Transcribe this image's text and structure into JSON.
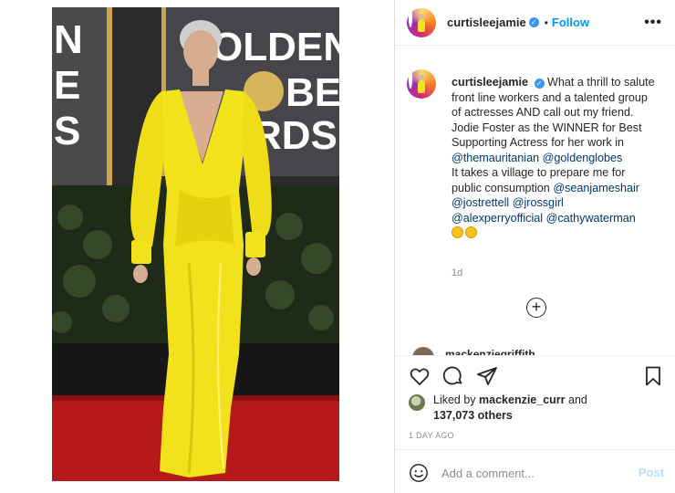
{
  "post": {
    "username": "curtisleejamie",
    "follow_label": "Follow",
    "separator": "•",
    "more_label": "•••",
    "verified_mark": "✓"
  },
  "caption": {
    "username": "curtisleejamie",
    "text_1": "What a thrill to salute front line workers and a talented group of actresses AND call out my friend. Jodie Foster as the WINNER for Best Supporting Actress for her work in ",
    "mention_1": "@themauritanian",
    "mention_2": "@goldenglobes",
    "text_2": "It takes a village to prepare me for public consumption ",
    "mention_3": "@seanjameshair",
    "mention_4": "@jostrettell",
    "mention_5": "@jrossgirl",
    "mention_6": "@alexperryofficial",
    "mention_7": "@cathywaterman",
    "emojis": [
      "clap-emoji",
      "clap-emoji"
    ]
  },
  "time_relative": "1d",
  "partial_comment": {
    "text": "mackenziegriffith"
  },
  "likes": {
    "prefix": "Liked by ",
    "user": "mackenzie_curr",
    "conj": " and",
    "count": "137,073 others"
  },
  "time_absolute": "1 DAY AGO",
  "comment_box": {
    "placeholder": "Add a comment...",
    "post_label": "Post"
  },
  "photo": {
    "backdrop_text": "GOLDEN GLOBE AWARDS",
    "backdrop_left_text": "N E S"
  },
  "colors": {
    "accent": "#0095f6",
    "dress": "#f2e21c",
    "carpet": "#b41818"
  }
}
